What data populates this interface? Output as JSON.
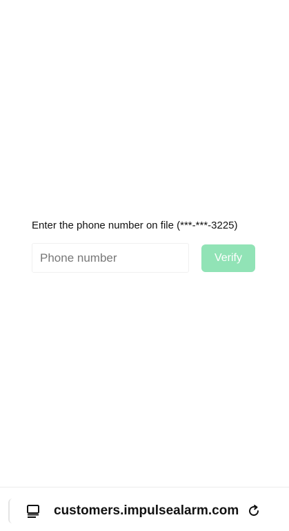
{
  "verification": {
    "prompt": "Enter the phone number on file (***-***-3225)",
    "phone_input": {
      "placeholder": "Phone number",
      "value": ""
    },
    "verify_label": "Verify",
    "verify_button_color": "#91e3b6"
  },
  "browser_bar": {
    "url": "customers.impulsealarm.com",
    "tabs_icon": "tabs-icon",
    "reload_icon": "reload-icon"
  }
}
